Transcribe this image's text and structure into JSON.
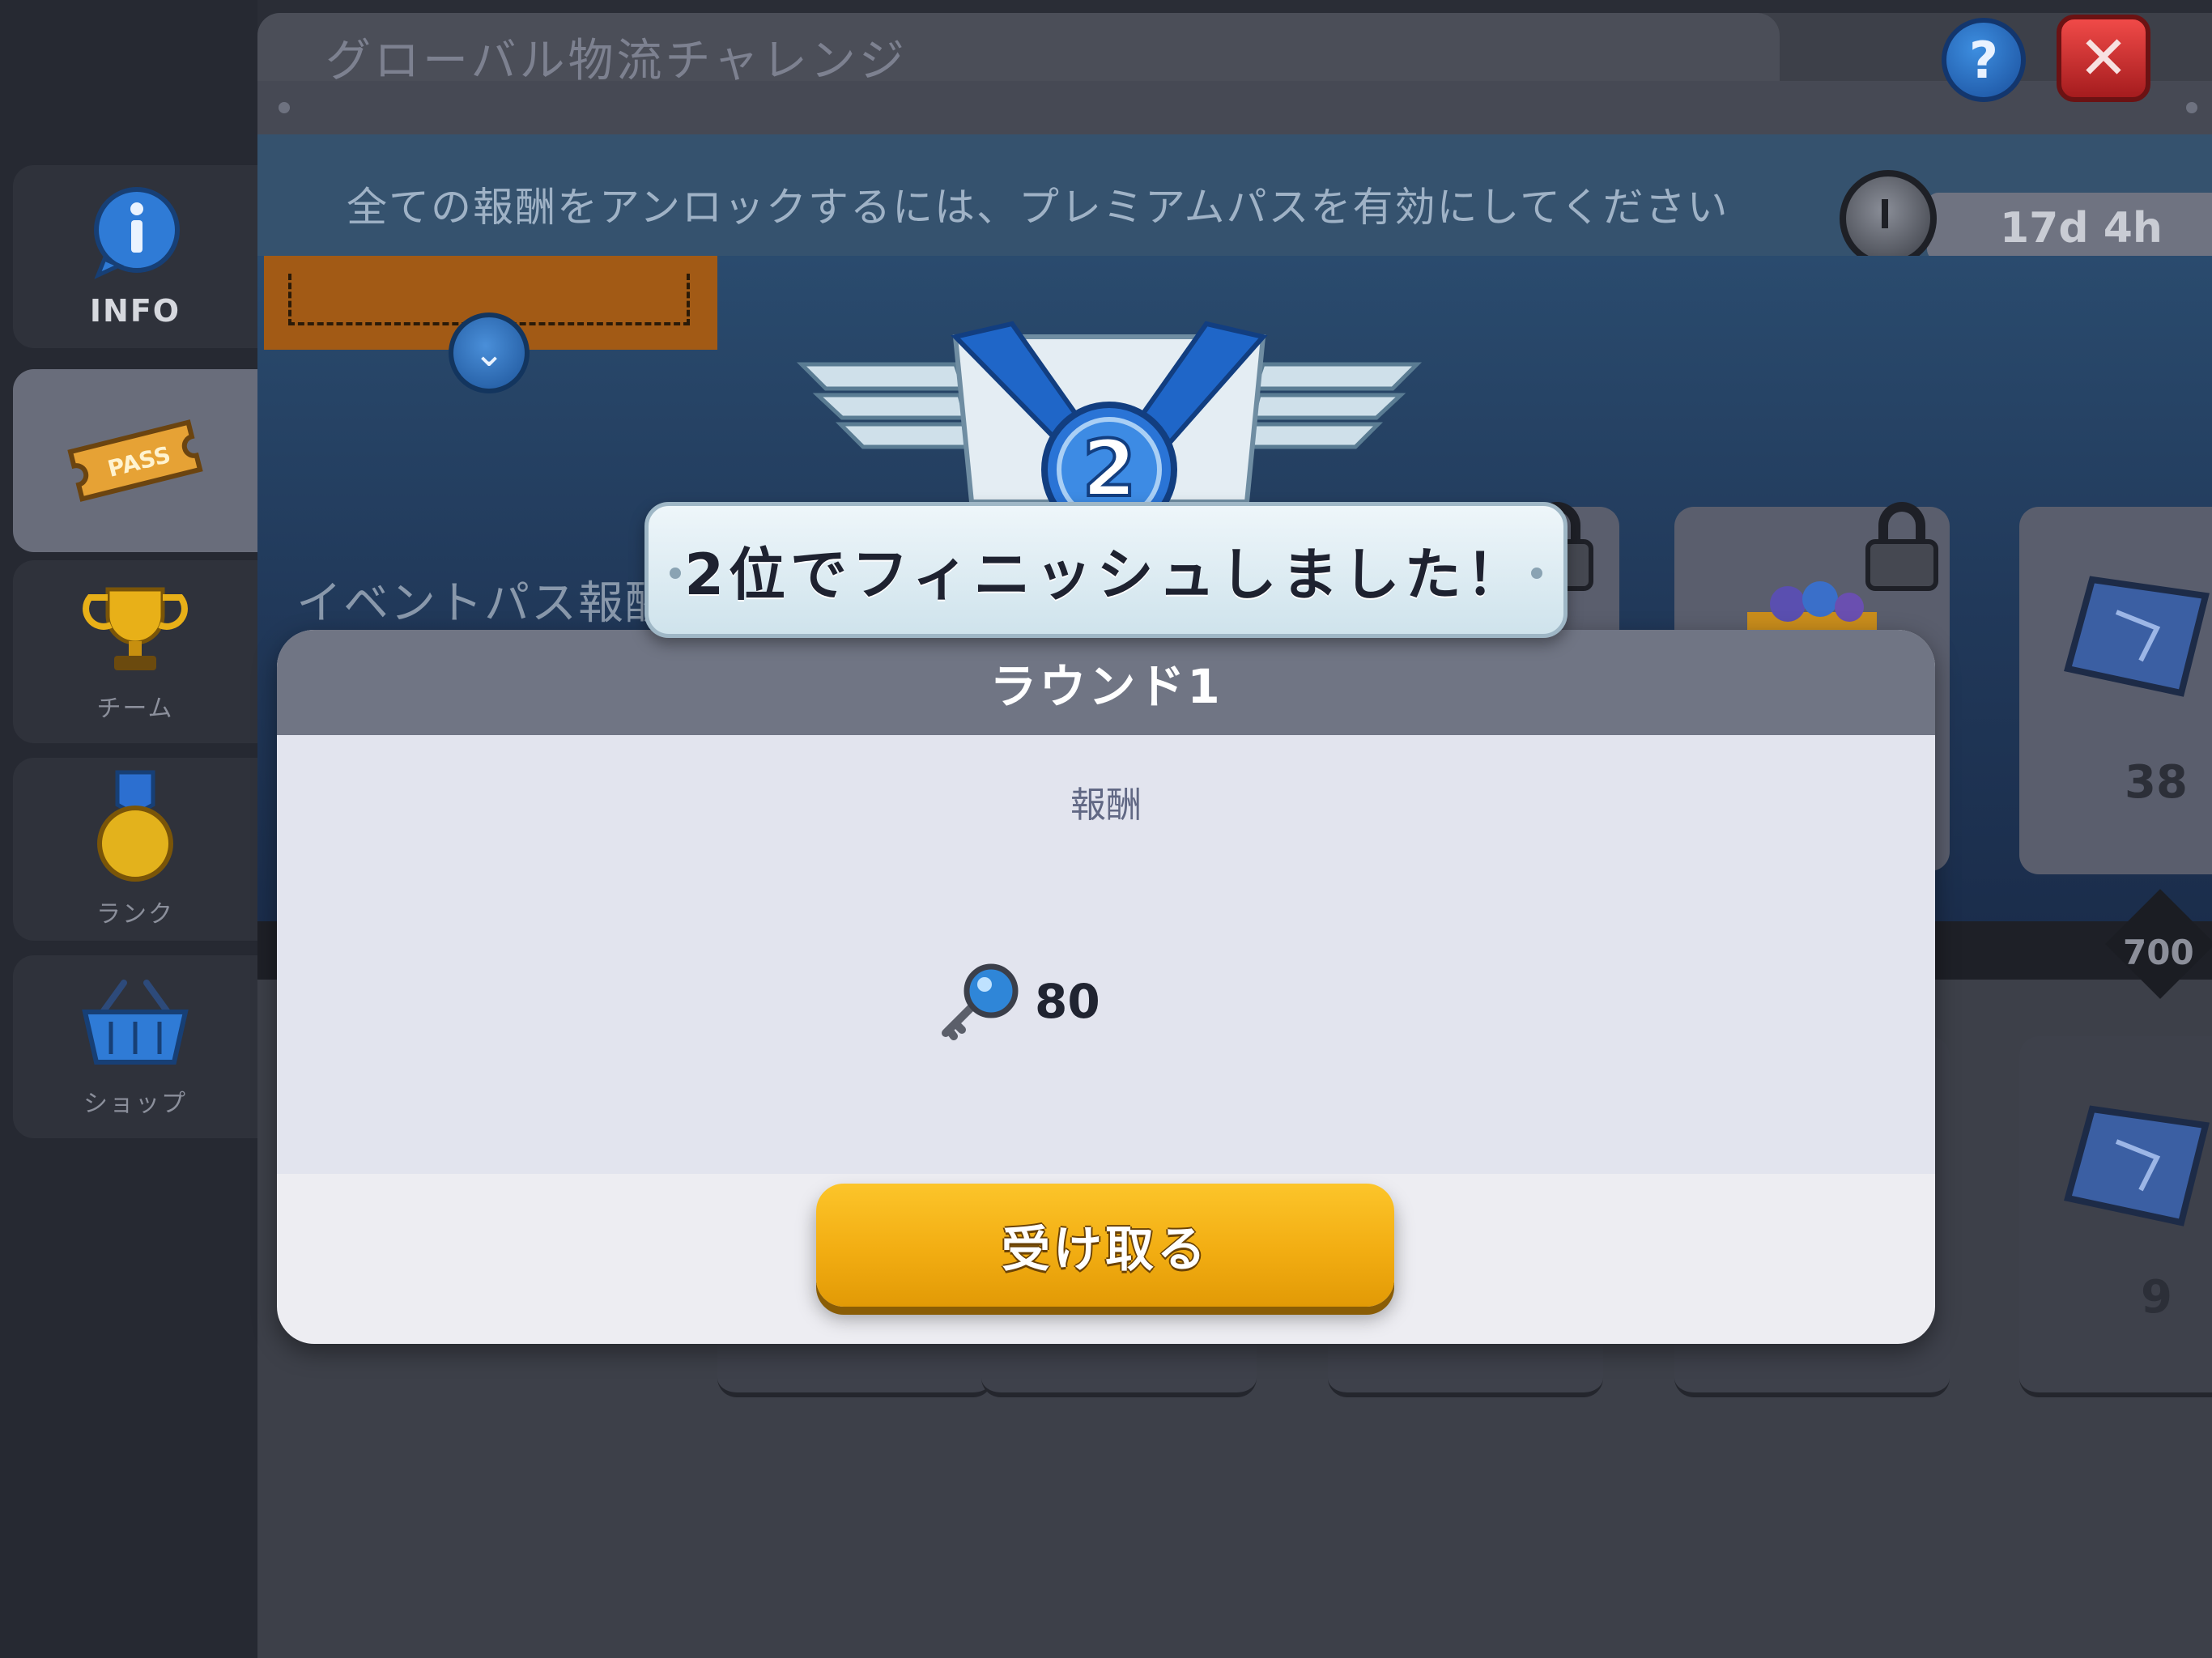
{
  "header": {
    "title": "グローバル物流チャレンジ",
    "help_symbol": "?",
    "close_symbol": "✕"
  },
  "banner": {
    "message": "全ての報酬をアンロックするには、プレミアムパスを有効にしてください",
    "timer": "17d 4h",
    "timer_icon": "stopwatch-icon"
  },
  "sidebar": {
    "items": [
      {
        "label": "INFO",
        "icon": "info-bubble-icon"
      },
      {
        "label": "PASS",
        "icon": "ticket-icon",
        "active": true
      },
      {
        "label": "チーム",
        "icon": "trophy-icon"
      },
      {
        "label": "ランク",
        "icon": "medal-icon"
      },
      {
        "label": "ショップ",
        "icon": "basket-icon"
      }
    ]
  },
  "pass": {
    "title": "イベントパス報酬",
    "chevron_symbol": "⌄",
    "card_counts": [
      "38",
      "9"
    ],
    "progress_marker": "700"
  },
  "finish": {
    "rank_number": "2",
    "message": "2位でフィニッシュしました！"
  },
  "modal": {
    "round_label": "ラウンド1",
    "reward_caption": "報酬",
    "reward_amount": "80",
    "reward_icon": "magnifier-key-icon",
    "claim_button_label": "受け取る"
  },
  "colors": {
    "accent_yellow": "#f2ad12",
    "header_gray": "#707584",
    "help_blue": "#1a4f9c",
    "close_red": "#d03233",
    "medal_blue": "#1f66c8"
  }
}
